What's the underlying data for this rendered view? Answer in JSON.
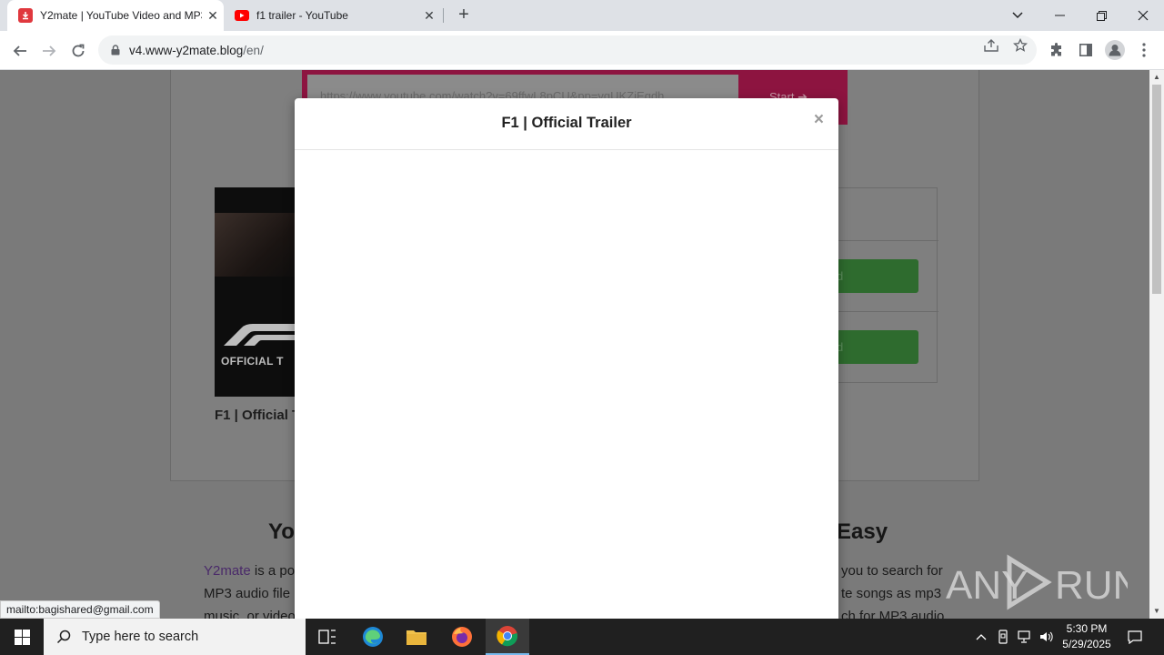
{
  "browser": {
    "tabs": [
      {
        "title": "Y2mate | YouTube Video and MP3",
        "favicon": "y2mate-download-icon",
        "active": true
      },
      {
        "title": "f1 trailer - YouTube",
        "favicon": "youtube-icon",
        "active": false
      }
    ],
    "new_tab": "+",
    "address": {
      "host": "v4.www-y2mate.blog",
      "path": "/en/"
    }
  },
  "page": {
    "search_input_value": "https://www.youtube.com/watch?v=69ffwL8pCU&pp=ygUKZjEgdh",
    "start_label": "Start ➔",
    "video_caption": "F1 | Official T",
    "thumb_label": "OFFICIAL T",
    "download_label_1": "d",
    "download_label_2": "d",
    "heading_left": "Yo",
    "heading_right": "Easy",
    "para_left": [
      {
        "link": "Y2mate",
        "text": " is a po"
      },
      {
        "link": "",
        "text": "MP3 audio file"
      },
      {
        "link": "",
        "text": "music, or video"
      }
    ],
    "para_right": [
      "you to search for",
      "te songs as mp3",
      "ch for MP3 audio"
    ]
  },
  "modal": {
    "title": "F1 | Official Trailer",
    "close": "×"
  },
  "status_tooltip": "mailto:bagishared@gmail.com",
  "watermark": "ANY RUN",
  "taskbar": {
    "search_placeholder": "Type here to search",
    "time": "5:30 PM",
    "date": "5/29/2025"
  },
  "colors": {
    "accent_red": "#c8174e",
    "green_button": "#4caf50",
    "taskbar_bg": "#202020"
  }
}
